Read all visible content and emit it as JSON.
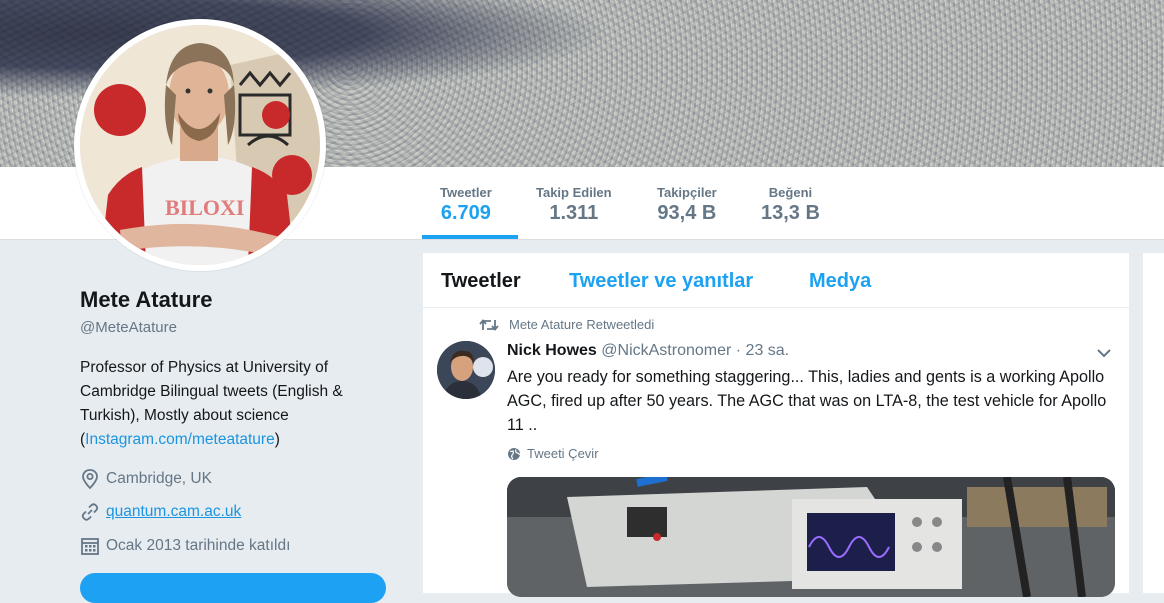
{
  "profile": {
    "name": "Mete Atature",
    "handle": "@MeteAtature",
    "bio": "Professor of Physics at University of Cambridge Bilingual tweets (English & Turkish), Mostly about science",
    "bio_link_open": "(",
    "bio_link": "Instagram.com/meteatature",
    "bio_link_close": ")",
    "location": "Cambridge, UK",
    "website": "quantum.cam.ac.uk",
    "joined": "Ocak 2013 tarihinde katıldı"
  },
  "stats": [
    {
      "label": "Tweetler",
      "value": "6.709"
    },
    {
      "label": "Takip Edilen",
      "value": "1.311"
    },
    {
      "label": "Takipçiler",
      "value": "93,4 B"
    },
    {
      "label": "Beğeni",
      "value": "13,3 B"
    }
  ],
  "timeline": {
    "tabs": [
      "Tweetler",
      "Tweetler ve yanıtlar",
      "Medya"
    ],
    "retweet_line": "Mete Atature Retweetledi",
    "tweet": {
      "author_name": "Nick Howes",
      "author_handle": "@NickAstronomer",
      "time": "· 23 sa.",
      "text": "Are you ready for something staggering... This, ladies and gents is a working Apollo AGC, fired up after 50 years. The AGC that was on LTA-8, the test vehicle for Apollo 11 ..",
      "translate": "Tweeti Çevir"
    }
  },
  "icons": {
    "retweet": "retweet-icon",
    "location": "location-pin-icon",
    "link": "link-icon",
    "calendar": "calendar-icon",
    "globe": "globe-icon",
    "caret": "chevron-down-icon"
  },
  "colors": {
    "accent": "#1da1f2",
    "link": "#1b95e0",
    "muted": "#657786",
    "background": "#e6ecf0"
  }
}
